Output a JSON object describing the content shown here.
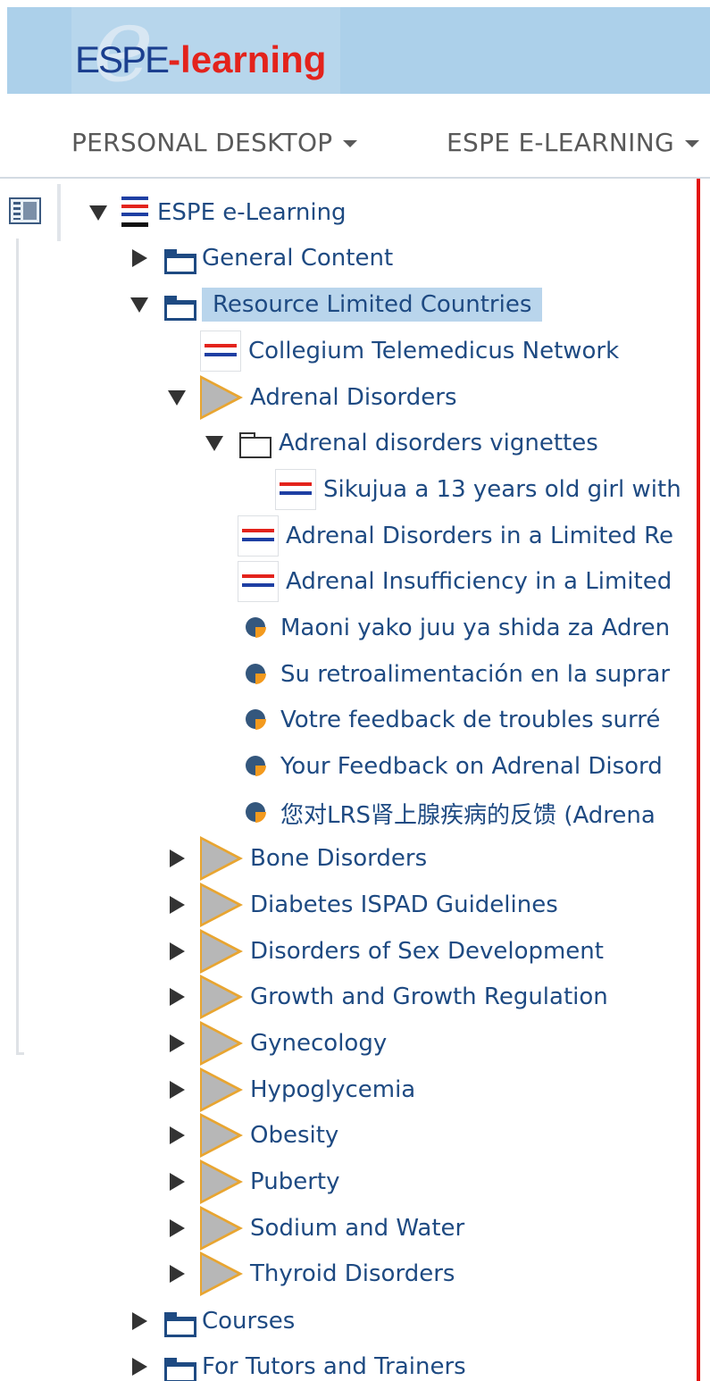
{
  "branding": {
    "logo_prefix": "ESPE",
    "logo_suffix": "-learning",
    "logo_e": "e"
  },
  "topnav": {
    "items": [
      {
        "label": "PERSONAL DESKTOP"
      },
      {
        "label": "ESPE E-LEARNING"
      }
    ]
  },
  "tree": {
    "root": {
      "label": "ESPE e-Learning",
      "icon": "course-flag-icon",
      "expanded": true
    },
    "nodes": [
      {
        "label": "General Content",
        "icon": "folder-icon",
        "expanded": false
      },
      {
        "label": "Resource Limited Countries",
        "icon": "folder-icon",
        "expanded": true,
        "selected": true
      },
      {
        "label": "Collegium Telemedicus Network",
        "icon": "course-flag-icon"
      },
      {
        "label": "Adrenal Disorders",
        "icon": "category-triangle-icon",
        "expanded": true
      },
      {
        "label": "Adrenal disorders vignettes",
        "icon": "folder-outline-icon",
        "expanded": true
      },
      {
        "label": "Sikujua a 13 years old girl with"
      },
      {
        "label": "Adrenal Disorders in a Limited Re"
      },
      {
        "label": "Adrenal Insufficiency in a Limited"
      },
      {
        "label": "Maoni yako juu ya shida za Adren",
        "icon": "survey-pie-icon"
      },
      {
        "label": "Su retroalimentación en la suprar",
        "icon": "survey-pie-icon"
      },
      {
        "label": "Votre feedback de troubles surré",
        "icon": "survey-pie-icon"
      },
      {
        "label": "Your Feedback on Adrenal Disord",
        "icon": "survey-pie-icon"
      },
      {
        "label": "您对LRS肾上腺疾病的反馈 (Adrena",
        "icon": "survey-pie-icon"
      },
      {
        "label": "Bone Disorders",
        "expanded": false
      },
      {
        "label": "Diabetes ISPAD Guidelines",
        "expanded": false
      },
      {
        "label": "Disorders of Sex Development",
        "expanded": false
      },
      {
        "label": "Growth and Growth Regulation",
        "expanded": false
      },
      {
        "label": "Gynecology",
        "expanded": false
      },
      {
        "label": "Hypoglycemia",
        "expanded": false
      },
      {
        "label": "Obesity",
        "expanded": false
      },
      {
        "label": "Puberty",
        "expanded": false
      },
      {
        "label": "Sodium and Water",
        "expanded": false
      },
      {
        "label": "Thyroid Disorders",
        "expanded": false
      },
      {
        "label": "Courses",
        "icon": "folder-icon",
        "expanded": false
      },
      {
        "label": "For Tutors and Trainers",
        "icon": "folder-icon",
        "expanded": false
      }
    ]
  },
  "colors": {
    "banner": "#acd0ea",
    "link": "#1e4a82",
    "selection": "#b9d5ec",
    "accent_red": "#e3130f",
    "category_orange": "#e8a531"
  }
}
